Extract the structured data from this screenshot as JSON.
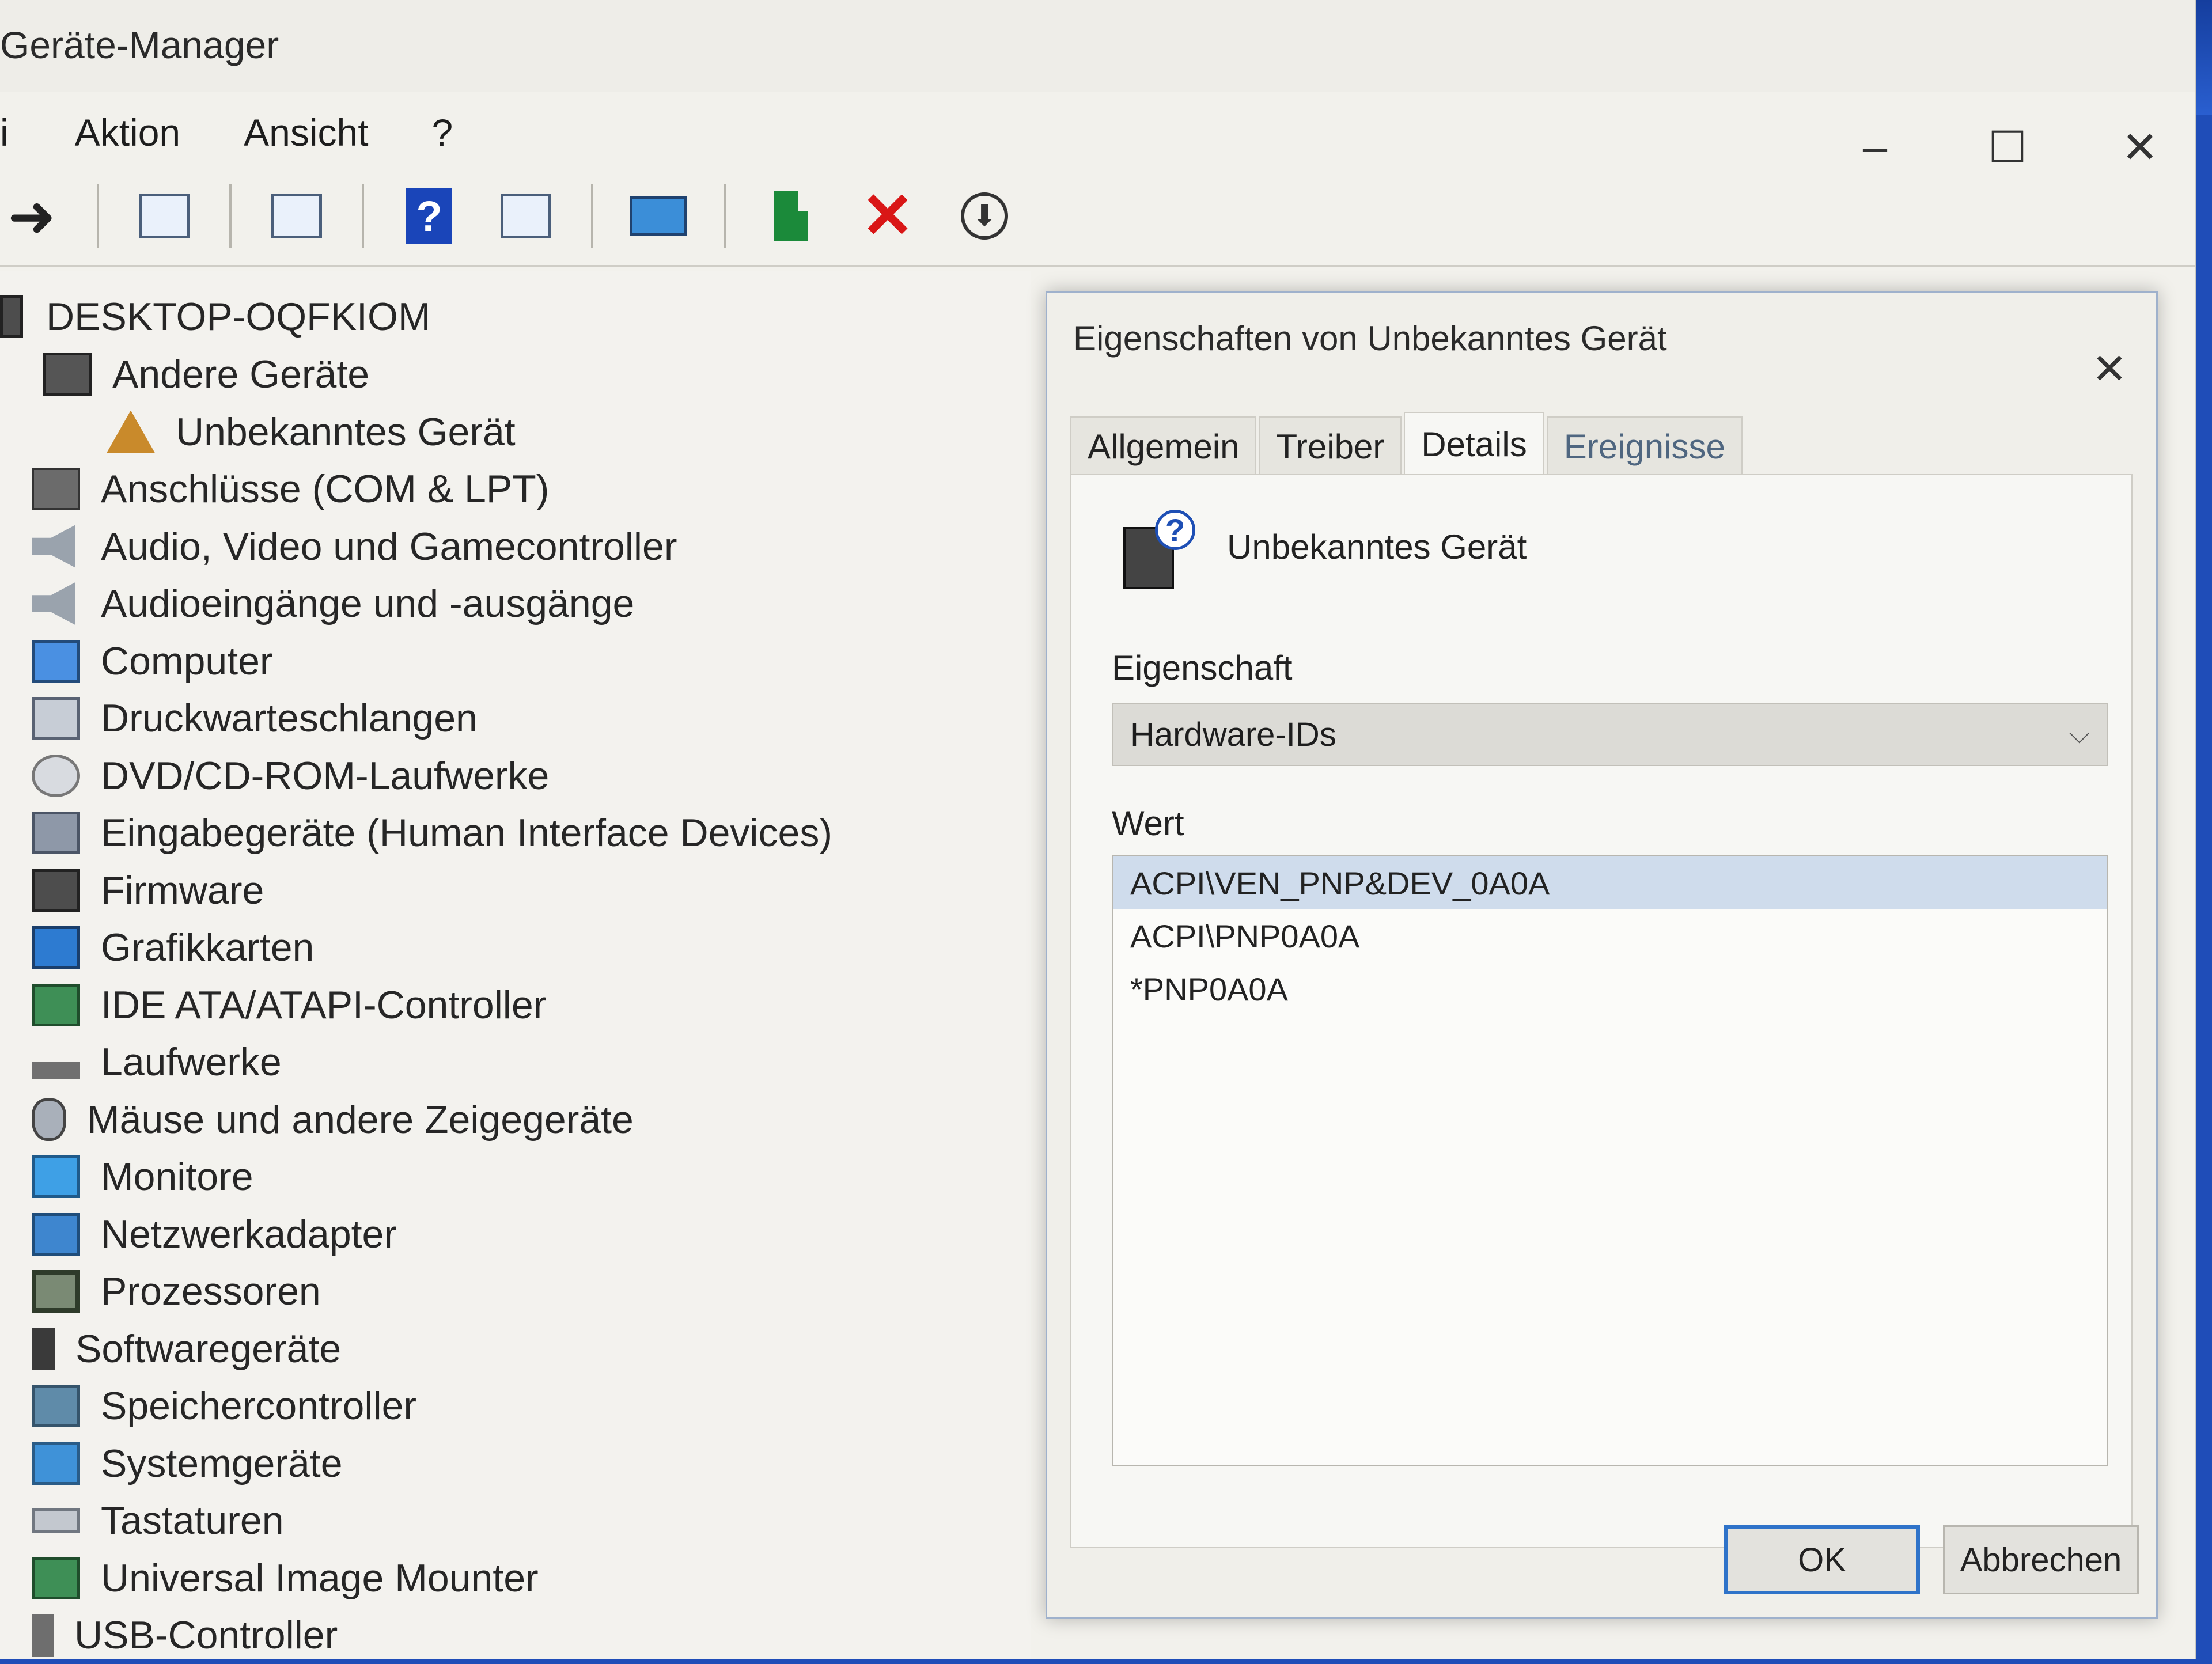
{
  "window": {
    "title": "Geräte-Manager",
    "controls": {
      "minimize": "–",
      "maximize": "☐",
      "close": "✕"
    }
  },
  "menu": [
    "i",
    "Aktion",
    "Ansicht",
    "?"
  ],
  "toolbar": {
    "icons": [
      "back-arrow-icon",
      "properties-pane-icon",
      "view-list-icon",
      "help-icon",
      "view-details-icon",
      "scan-monitor-icon",
      "update-driver-icon",
      "uninstall-icon",
      "download-icon"
    ],
    "delete_glyph": "✕",
    "help_glyph": "?",
    "arrow_glyph": "➜",
    "down_glyph": "⬇"
  },
  "tree": {
    "root": "DESKTOP-OQFKIOM",
    "categories": [
      {
        "label": "Andere Geräte",
        "icon": "unknown-device-icon",
        "expanded": true
      },
      {
        "label": "Unbekanntes Gerät",
        "icon": "warning-device-icon",
        "child": true
      },
      {
        "label": "Anschlüsse (COM & LPT)",
        "icon": "port-icon"
      },
      {
        "label": "Audio, Video und Gamecontroller",
        "icon": "speaker-icon"
      },
      {
        "label": "Audioeingänge und -ausgänge",
        "icon": "speaker-icon"
      },
      {
        "label": "Computer",
        "icon": "computer-icon"
      },
      {
        "label": "Druckwarteschlangen",
        "icon": "printer-icon"
      },
      {
        "label": "DVD/CD-ROM-Laufwerke",
        "icon": "disc-icon"
      },
      {
        "label": "Eingabegeräte (Human Interface Devices)",
        "icon": "hid-icon"
      },
      {
        "label": "Firmware",
        "icon": "firmware-icon"
      },
      {
        "label": "Grafikkarten",
        "icon": "display-adapter-icon"
      },
      {
        "label": "IDE ATA/ATAPI-Controller",
        "icon": "ide-controller-icon"
      },
      {
        "label": "Laufwerke",
        "icon": "drive-icon"
      },
      {
        "label": "Mäuse und andere Zeigegeräte",
        "icon": "mouse-icon"
      },
      {
        "label": "Monitore",
        "icon": "monitor-icon"
      },
      {
        "label": "Netzwerkadapter",
        "icon": "network-adapter-icon"
      },
      {
        "label": "Prozessoren",
        "icon": "processor-icon"
      },
      {
        "label": "Softwaregeräte",
        "icon": "software-device-icon"
      },
      {
        "label": "Speichercontroller",
        "icon": "storage-controller-icon"
      },
      {
        "label": "Systemgeräte",
        "icon": "system-device-icon"
      },
      {
        "label": "Tastaturen",
        "icon": "keyboard-icon"
      },
      {
        "label": "Universal Image Mounter",
        "icon": "image-mounter-icon"
      },
      {
        "label": "USB-Controller",
        "icon": "usb-icon"
      }
    ]
  },
  "dialog": {
    "title": "Eigenschaften von Unbekanntes Gerät",
    "close": "✕",
    "tabs": [
      "Allgemein",
      "Treiber",
      "Details",
      "Ereignisse"
    ],
    "active_tab": "Details",
    "device_name": "Unbekanntes Gerät",
    "device_icon_glyph": "?",
    "property_label": "Eigenschaft",
    "property_value": "Hardware-IDs",
    "value_label": "Wert",
    "values": [
      "ACPI\\VEN_PNP&DEV_0A0A",
      "ACPI\\PNP0A0A",
      "*PNP0A0A"
    ],
    "selected_value_index": 0,
    "ok": "OK",
    "cancel": "Abbrechen"
  },
  "colors": {
    "desktop": "#1f4db8",
    "selection": "#cfdcec",
    "default_button_border": "#2f73c9",
    "delete_red": "#d91616"
  }
}
